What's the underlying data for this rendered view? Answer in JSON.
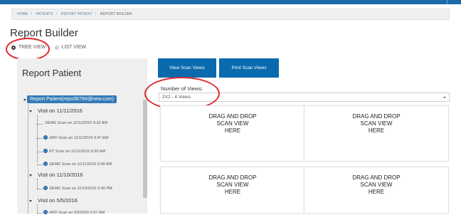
{
  "breadcrumb": [
    "HOME",
    "PATIENTS",
    "REPORT PATIENT",
    "REPORT BUILDER"
  ],
  "page_title": "Report Builder",
  "view_toggle": {
    "tree": "TREE VIEW",
    "list": "LIST VIEW",
    "selected": "tree"
  },
  "left_panel": {
    "title": "Report Patient",
    "root": "Report Patient(repo3679rt@new.com)",
    "visits": [
      {
        "label": "Visit on 11/11/2016",
        "scans": [
          {
            "label": "SEMG Scan on 11/11/2016 9:32 AM",
            "icon": ""
          },
          {
            "label": "HRV Scan on 11/11/2016 9:47 AM",
            "icon": "scan-icon"
          },
          {
            "label": "RT Scan on 11/11/2016 9:30 AM",
            "icon": "scan-icon"
          },
          {
            "label": "SEMG Scan on 11/11/2016 9:38 AM",
            "icon": "scan-icon"
          }
        ]
      },
      {
        "label": "Visit on 11/10/2016",
        "scans": [
          {
            "label": "SEMG Scan on 11/10/2016 5:46 PM",
            "icon": "scan-icon"
          }
        ]
      },
      {
        "label": "Visit on 5/5/2016",
        "scans": [
          {
            "label": "HRV Scan on 5/5/2016 5:57 AM",
            "icon": "scan-icon"
          }
        ]
      }
    ]
  },
  "buttons": {
    "view_scan_views": "View Scan Views",
    "print_scan_views": "Print Scan Views"
  },
  "views_select": {
    "label": "Number of Views:",
    "value": "2X2 - 4 Views"
  },
  "drop_zone": {
    "line1": "DRAG AND DROP",
    "line2": "SCAN VIEW",
    "line3": "HERE"
  },
  "colors": {
    "primary": "#0a6aae",
    "highlight": "#e0262d",
    "topbar": "#1c6aa8"
  }
}
